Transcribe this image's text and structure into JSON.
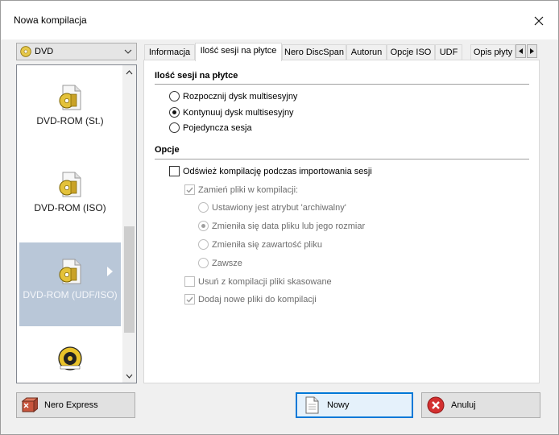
{
  "window": {
    "title": "Nowa kompilacja"
  },
  "disc_type_combo": {
    "value": "DVD",
    "icon": "disc-icon"
  },
  "compilation_list": {
    "items": [
      {
        "label": "DVD-ROM (St.)",
        "icon": "dvd-rom-standard-icon",
        "selected": false
      },
      {
        "label": "DVD-ROM (ISO)",
        "icon": "dvd-rom-iso-icon",
        "selected": false
      },
      {
        "label": "DVD-ROM (UDF/ISO)",
        "icon": "dvd-rom-udf-iso-icon",
        "selected": true
      },
      {
        "label": "",
        "icon": "securdisc-icon",
        "selected": false
      }
    ]
  },
  "tabs": [
    {
      "label": "Informacja",
      "active": false
    },
    {
      "label": "Ilość sesji na płytce",
      "active": true
    },
    {
      "label": "Nero DiscSpan",
      "active": false
    },
    {
      "label": "Autorun",
      "active": false
    },
    {
      "label": "Opcje ISO",
      "active": false
    },
    {
      "label": "UDF",
      "active": false
    },
    {
      "label": "Opis płyty",
      "active": false
    }
  ],
  "multisession": {
    "title": "Ilość sesji na płytce",
    "options": [
      {
        "label": "Rozpocznij dysk multisesyjny",
        "checked": false
      },
      {
        "label": "Kontynuuj dysk multisesyjny",
        "checked": true
      },
      {
        "label": "Pojedyncza sesja",
        "checked": false
      }
    ]
  },
  "options": {
    "title": "Opcje",
    "refresh_label": "Odśwież kompilację podczas importowania sesji",
    "refresh_checked": false,
    "replace_label": "Zamień pliki w kompilacji:",
    "replace_checked": true,
    "replace_options": [
      {
        "label": "Ustawiony jest atrybut 'archiwalny'",
        "checked": false
      },
      {
        "label": "Zmieniła się data pliku lub jego rozmiar",
        "checked": true
      },
      {
        "label": "Zmieniła się zawartość pliku",
        "checked": false
      },
      {
        "label": "Zawsze",
        "checked": false
      }
    ],
    "remove_deleted_label": "Usuń z kompilacji pliki skasowane",
    "remove_deleted_checked": false,
    "add_new_label": "Dodaj nowe pliki do kompilacji",
    "add_new_checked": true
  },
  "buttons": {
    "nero_express": "Nero Express",
    "new": "Nowy",
    "cancel": "Anuluj"
  },
  "colors": {
    "selection": "#b9c7d8",
    "default_button_border": "#0078d7",
    "cancel_icon": "#d32f2f"
  }
}
